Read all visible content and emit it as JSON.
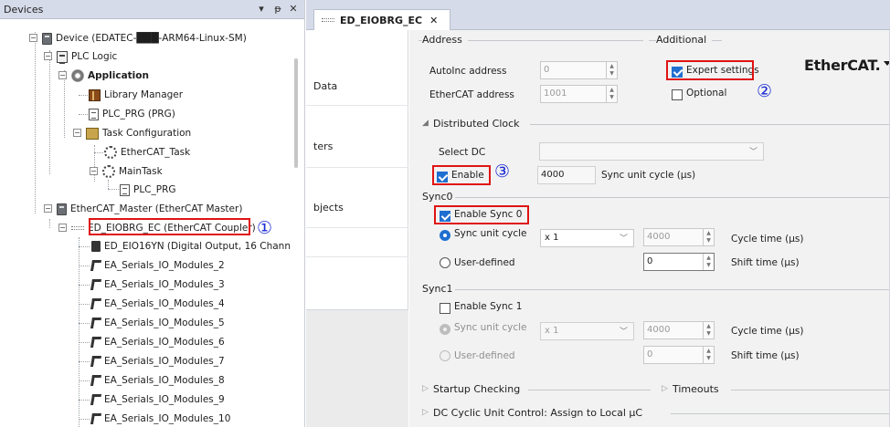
{
  "devices_panel": {
    "title": "Devices",
    "header_buttons": [
      "▾",
      "ᵽ",
      "✕"
    ],
    "tree": [
      {
        "label": "Device (EDATEC-███-ARM64-Linux-SM)",
        "icon": "device-icon",
        "bold": false
      },
      {
        "label": "PLC Logic",
        "icon": "plc-logic-icon",
        "bold": false
      },
      {
        "label": "Application",
        "icon": "application-icon",
        "bold": true
      },
      {
        "label": "Library Manager",
        "icon": "library-icon",
        "bold": false
      },
      {
        "label": "PLC_PRG (PRG)",
        "icon": "program-icon",
        "bold": false
      },
      {
        "label": "Task Configuration",
        "icon": "task-config-icon",
        "bold": false
      },
      {
        "label": "EtherCAT_Task",
        "icon": "task-icon",
        "bold": false
      },
      {
        "label": "MainTask",
        "icon": "task-icon",
        "bold": false
      },
      {
        "label": "PLC_PRG",
        "icon": "program-call-icon",
        "bold": false
      },
      {
        "label": "EtherCAT_Master (EtherCAT Master)",
        "icon": "device-icon",
        "bold": false
      },
      {
        "label": "ED_EIOBRG_EC (EtherCAT Coupler)",
        "icon": "coupler-icon",
        "bold": false
      },
      {
        "label": "ED_EIO16YN (Digital Output, 16 Channels",
        "icon": "module-icon",
        "bold": false
      },
      {
        "label": "EA_Serials_IO_Modules_2",
        "icon": "io-module-icon",
        "bold": false
      },
      {
        "label": "EA_Serials_IO_Modules_3",
        "icon": "io-module-icon",
        "bold": false
      },
      {
        "label": "EA_Serials_IO_Modules_4",
        "icon": "io-module-icon",
        "bold": false
      },
      {
        "label": "EA_Serials_IO_Modules_5",
        "icon": "io-module-icon",
        "bold": false
      },
      {
        "label": "EA_Serials_IO_Modules_6",
        "icon": "io-module-icon",
        "bold": false
      },
      {
        "label": "EA_Serials_IO_Modules_7",
        "icon": "io-module-icon",
        "bold": false
      },
      {
        "label": "EA_Serials_IO_Modules_8",
        "icon": "io-module-icon",
        "bold": false
      },
      {
        "label": "EA_Serials_IO_Modules_9",
        "icon": "io-module-icon",
        "bold": false
      },
      {
        "label": "EA_Serials_IO_Modules_10",
        "icon": "io-module-icon",
        "bold": false
      }
    ]
  },
  "annotations": [
    "①",
    "②",
    "③"
  ],
  "annotation_color": "#1a2bd4",
  "highlight_color": "#e01313",
  "editor": {
    "tab_label": "ED_EIOBRG_EC",
    "tab_close": "✕",
    "left_nav": [
      "Data",
      "ters",
      "bjects"
    ],
    "logo": {
      "prefix": "Ether",
      "suffix": "CAT."
    },
    "address": {
      "title": "Address",
      "autoinc_label": "AutoInc address",
      "autoinc_value": "0",
      "ethercat_label": "EtherCAT address",
      "ethercat_value": "1001"
    },
    "additional": {
      "title": "Additional",
      "expert_label": "Expert settings",
      "expert_checked": true,
      "optional_label": "Optional",
      "optional_checked": false
    },
    "dc": {
      "title": "Distributed Clock",
      "select_label": "Select DC",
      "select_value": "",
      "enable_label": "Enable",
      "enable_checked": true,
      "cycle_value": "4000",
      "cycle_label": "Sync unit cycle (µs)"
    },
    "sync0": {
      "title": "Sync0",
      "enable_label": "Enable Sync 0",
      "enable_checked": true,
      "sync_unit_label": "Sync unit cycle",
      "multiplier": "x 1",
      "cycle_value": "4000",
      "cycle_label": "Cycle time (µs)",
      "user_defined_label": "User-defined",
      "shift_value": "0",
      "shift_label": "Shift time (µs)"
    },
    "sync1": {
      "title": "Sync1",
      "enable_label": "Enable Sync 1",
      "enable_checked": false,
      "sync_unit_label": "Sync unit cycle",
      "multiplier": "x 1",
      "cycle_value": "4000",
      "cycle_label": "Cycle time (µs)",
      "user_defined_label": "User-defined",
      "shift_value": "0",
      "shift_label": "Shift time (µs)"
    },
    "startup_checking": "Startup Checking",
    "timeouts": "Timeouts",
    "dc_cyclic": "DC Cyclic Unit Control: Assign to Local µC"
  }
}
